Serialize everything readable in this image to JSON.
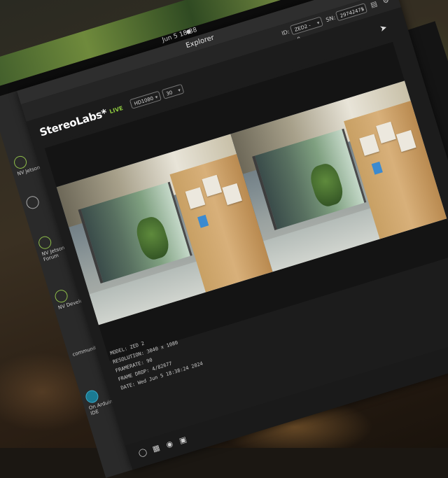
{
  "menubar": {
    "clock": "Jun 5 18:38",
    "bell": "●"
  },
  "window": {
    "title": "Explorer"
  },
  "toolbar": {
    "id_label": "ID:",
    "camera_select": "ZED2 - 0",
    "sn_label": "SN:",
    "serial_select": "29742475"
  },
  "header": {
    "brand": "StereoLabs*",
    "live_badge": "LIVE",
    "resolution_select": "HD1080",
    "fps_select": "30"
  },
  "info": {
    "model": "MODEL: ZED 2",
    "resolution": "RESOLUTION: 3840 x 1080",
    "framerate": "FRAMERATE: 90",
    "frame_drop": "FRAME DROP: 4/82677",
    "date": "DATE: Wed Jun 5 18:38:24 2024"
  },
  "dock": [
    {
      "label": "NV",
      "sub": "Jetson"
    },
    {
      "label": "",
      "sub": ""
    },
    {
      "label": "NV",
      "sub": "Jetson Forum"
    },
    {
      "label": "NV",
      "sub": "Develop"
    },
    {
      "label": "",
      "sub": "communit"
    },
    {
      "label": "On",
      "sub": "Arduino IDE"
    }
  ],
  "icons": {
    "folder": "folder-icon",
    "settings": "gear-icon",
    "cursor": "cursor-icon",
    "record": "record-icon",
    "camera": "camera-icon",
    "signal": "signal-icon",
    "video": "video-icon"
  },
  "colors": {
    "accent_live": "#8cc63f",
    "window_bg": "#1c1c1c"
  }
}
